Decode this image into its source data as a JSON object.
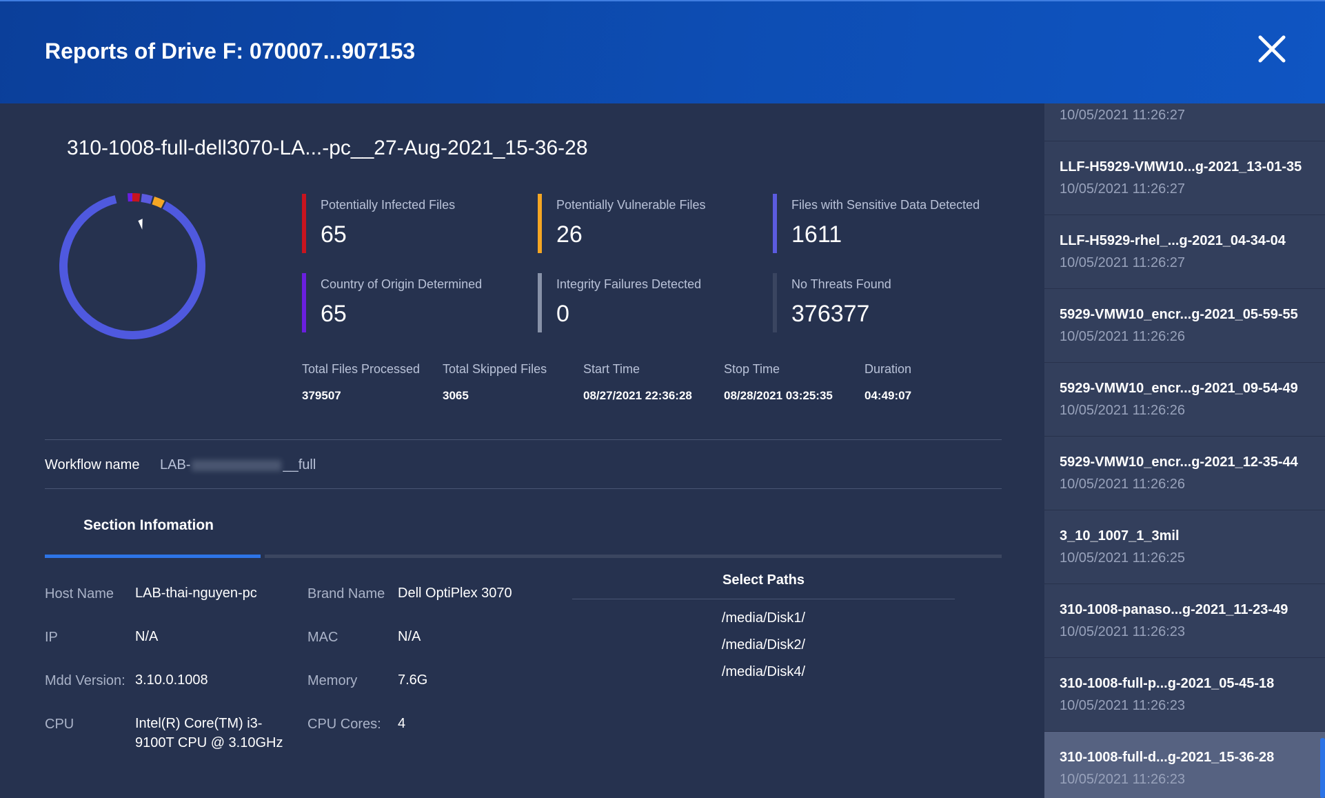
{
  "header": {
    "title": "Reports of Drive F: 070007...907153"
  },
  "report": {
    "title": "310-1008-full-dell3070-LA...-pc__27-Aug-2021_15-36-28",
    "donut": {
      "segments": [
        {
          "name": "Potentially Infected Files",
          "value": 65,
          "color": "#c8141e"
        },
        {
          "name": "Potentially Vulnerable Files",
          "value": 26,
          "color": "#f5a623"
        },
        {
          "name": "Files with Sensitive Data Detected",
          "value": 1611,
          "color": "#5b5be0"
        },
        {
          "name": "Country of Origin Determined",
          "value": 65,
          "color": "#6a1fe0"
        },
        {
          "name": "Integrity Failures Detected",
          "value": 0,
          "color": "#8892a8"
        },
        {
          "name": "No Threats Found",
          "value": 376377,
          "color": "#4f59df"
        }
      ]
    },
    "stats": [
      {
        "label": "Potentially Infected Files",
        "value": "65",
        "color": "#c8141e"
      },
      {
        "label": "Potentially Vulnerable Files",
        "value": "26",
        "color": "#f5a623"
      },
      {
        "label": "Files with Sensitive Data Detected",
        "value": "1611",
        "color": "#5b5be0"
      },
      {
        "label": "Country of Origin Determined",
        "value": "65",
        "color": "#6a1fe0"
      },
      {
        "label": "Integrity Failures Detected",
        "value": "0",
        "color": "#8892a8"
      },
      {
        "label": "No Threats Found",
        "value": "376377",
        "color": "#3a4560"
      }
    ],
    "meta": [
      {
        "label": "Total Files Processed",
        "value": "379507"
      },
      {
        "label": "Total Skipped Files",
        "value": "3065"
      },
      {
        "label": "Start Time",
        "value": "08/27/2021 22:36:28"
      },
      {
        "label": "Stop Time",
        "value": "08/28/2021 03:25:35"
      },
      {
        "label": "Duration",
        "value": "04:49:07"
      }
    ],
    "workflow": {
      "label": "Workflow name",
      "value_prefix": "LAB-",
      "value_suffix": "__full"
    }
  },
  "section": {
    "tab_label": "Section Infomation",
    "host_name_label": "Host Name",
    "host_name": "LAB-thai-nguyen-pc",
    "brand_name_label": "Brand Name",
    "brand_name": "Dell OptiPlex 3070",
    "ip_label": "IP",
    "ip": "N/A",
    "mac_label": "MAC",
    "mac": "N/A",
    "mdd_label": "Mdd Version:",
    "mdd": "3.10.0.1008",
    "memory_label": "Memory",
    "memory": "7.6G",
    "cpu_label": "CPU",
    "cpu": "Intel(R) Core(TM) i3-9100T CPU @ 3.10GHz",
    "cores_label": "CPU Cores:",
    "cores": "4",
    "paths_title": "Select Paths",
    "paths": [
      "/media/Disk1/",
      "/media/Disk2/",
      "/media/Disk4/"
    ]
  },
  "sidebar": {
    "items": [
      {
        "name": "",
        "time": "10/05/2021 11:26:27"
      },
      {
        "name": "LLF-H5929-VMW10...g-2021_13-01-35",
        "time": "10/05/2021 11:26:27"
      },
      {
        "name": "LLF-H5929-rhel_...g-2021_04-34-04",
        "time": "10/05/2021 11:26:27"
      },
      {
        "name": "5929-VMW10_encr...g-2021_05-59-55",
        "time": "10/05/2021 11:26:26"
      },
      {
        "name": "5929-VMW10_encr...g-2021_09-54-49",
        "time": "10/05/2021 11:26:26"
      },
      {
        "name": "5929-VMW10_encr...g-2021_12-35-44",
        "time": "10/05/2021 11:26:26"
      },
      {
        "name": "3_10_1007_1_3mil",
        "time": "10/05/2021 11:26:25"
      },
      {
        "name": "310-1008-panaso...g-2021_11-23-49",
        "time": "10/05/2021 11:26:23"
      },
      {
        "name": "310-1008-full-p...g-2021_05-45-18",
        "time": "10/05/2021 11:26:23"
      },
      {
        "name": "310-1008-full-d...g-2021_15-36-28",
        "time": "10/05/2021 11:26:23"
      }
    ]
  }
}
